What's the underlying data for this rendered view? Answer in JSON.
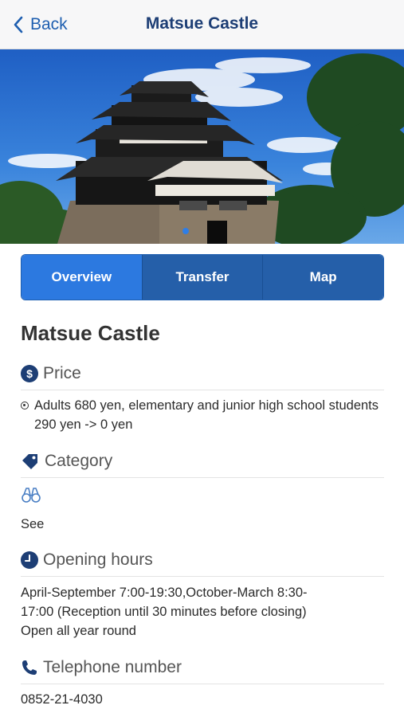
{
  "nav": {
    "back_label": "Back",
    "title": "Matsue Castle"
  },
  "tabs": [
    {
      "label": "Overview",
      "active": true
    },
    {
      "label": "Transfer",
      "active": false
    },
    {
      "label": "Map",
      "active": false
    }
  ],
  "carousel": {
    "current_page": 1
  },
  "place": {
    "title": "Matsue Castle"
  },
  "sections": {
    "price": {
      "heading": "Price",
      "icon": "dollar-icon",
      "text": "Adults 680 yen, elementary and junior high school students 290 yen -> 0 yen"
    },
    "category": {
      "heading": "Category",
      "icon": "tag-icon",
      "item_icon": "binoculars-icon",
      "value": "See"
    },
    "hours": {
      "heading": "Opening hours",
      "icon": "clock-icon",
      "line1": "April-September 7:00-19:30,October-March 8:30-",
      "line2": "17:00 (Reception until 30 minutes before closing)",
      "line3": "Open all year round"
    },
    "phone": {
      "heading": "Telephone number",
      "icon": "phone-icon",
      "value": "0852-21-4030"
    }
  },
  "colors": {
    "accent": "#2c79e0",
    "tab_inactive": "#255fa9",
    "nav_title": "#1d3e75",
    "icon": "#1d3e75"
  }
}
